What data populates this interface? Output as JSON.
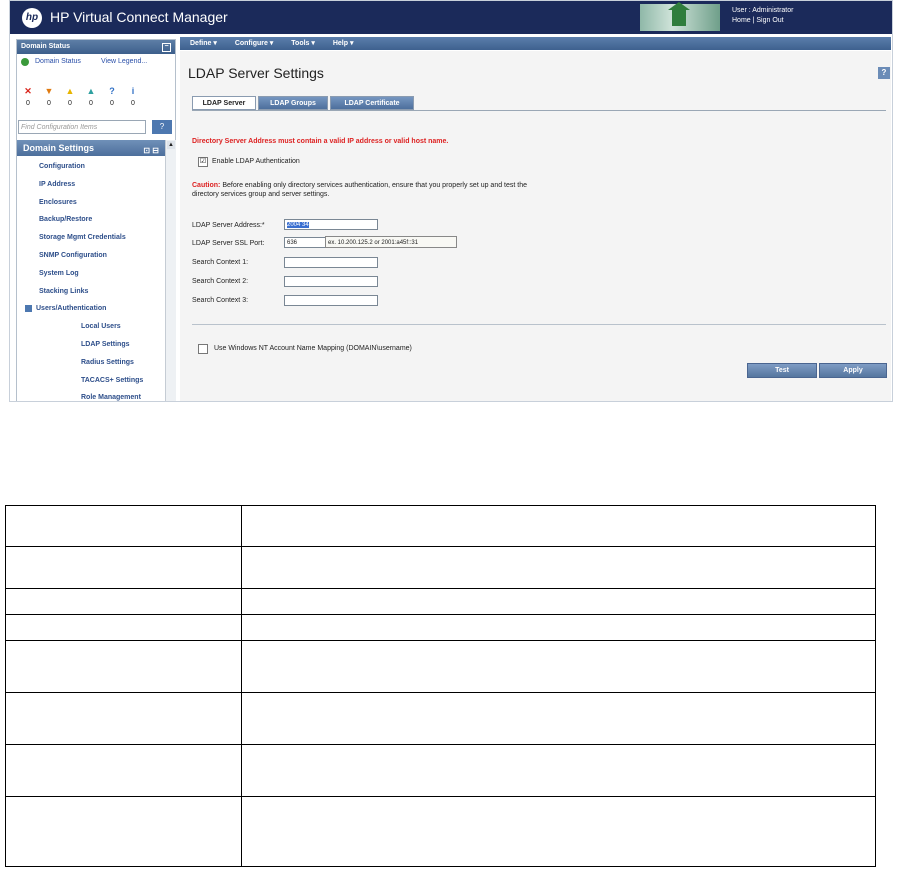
{
  "header": {
    "logo": "hp",
    "title": "HP Virtual Connect Manager",
    "user_line": "User : Administrator",
    "links_line": "Home  |  Sign Out"
  },
  "left_pane": {
    "domain_status_title": "Domain Status",
    "domain_status_link": "Domain Status",
    "view_legend_link": "View Legend...",
    "status_icons": [
      {
        "icon": "critical-icon",
        "symbol": "✕",
        "color": "#d9241b",
        "count": "0"
      },
      {
        "icon": "major-icon",
        "symbol": "▼",
        "color": "#e07a10",
        "count": "0"
      },
      {
        "icon": "minor-icon",
        "symbol": "▲",
        "color": "#e7b500",
        "count": "0"
      },
      {
        "icon": "warning-icon",
        "symbol": "▲",
        "color": "#2ea0a0",
        "count": "0"
      },
      {
        "icon": "unknown-icon",
        "symbol": "?",
        "color": "#2f6fc5",
        "count": "0"
      },
      {
        "icon": "info-icon",
        "symbol": "i",
        "color": "#2f6fc5",
        "count": "0"
      }
    ],
    "find_placeholder": "Find Configuration Items",
    "help_label": "?",
    "domain_settings_title": "Domain Settings",
    "nav_items": [
      {
        "label": "Configuration",
        "level": "l1"
      },
      {
        "label": "IP Address",
        "level": "l1"
      },
      {
        "label": "Enclosures",
        "level": "l1"
      },
      {
        "label": "Backup/Restore",
        "level": "l1"
      },
      {
        "label": "Storage Mgmt Credentials",
        "level": "l1"
      },
      {
        "label": "SNMP Configuration",
        "level": "l1"
      },
      {
        "label": "System Log",
        "level": "l1"
      },
      {
        "label": "Stacking Links",
        "level": "l1"
      },
      {
        "label": "Users/Authentication",
        "level": "grp"
      },
      {
        "label": "Local Users",
        "level": "l2"
      },
      {
        "label": "LDAP Settings",
        "level": "l2"
      },
      {
        "label": "Radius Settings",
        "level": "l2"
      },
      {
        "label": "TACACS+ Settings",
        "level": "l2"
      },
      {
        "label": "Role Management",
        "level": "l2"
      }
    ]
  },
  "menubar": {
    "define": "Define ▾",
    "configure": "Configure ▾",
    "tools": "Tools ▾",
    "help": "Help ▾"
  },
  "page": {
    "title": "LDAP Server Settings",
    "help_icon": "?",
    "tabs": [
      "LDAP Server",
      "LDAP Groups",
      "LDAP Certificate"
    ],
    "error_text": "Directory Server Address must contain a valid IP address or valid host name.",
    "enable_ldap_label": "Enable LDAP Authentication",
    "enable_ldap_checked": "☑",
    "caution_label": "Caution:",
    "caution_text": " Before enabling only directory services authentication, ensure that you properly set up and test the directory services group and server settings.",
    "fields": [
      {
        "label": "LDAP Server Address:*",
        "value": "2004 34"
      },
      {
        "label": "LDAP Server SSL Port:",
        "value": "636"
      },
      {
        "label": "Search Context 1:",
        "value": ""
      },
      {
        "label": "Search Context 2:",
        "value": ""
      },
      {
        "label": "Search Context 3:",
        "value": ""
      }
    ],
    "tooltip": "ex. 10.200.125.2 or 2001:a45f::31",
    "nt_mapping_label": "Use Windows NT Account Name Mapping (DOMAIN\\username)",
    "test_button": "Test",
    "apply_button": "Apply"
  },
  "table": {
    "rows": [
      [
        "",
        ""
      ],
      [
        "",
        ""
      ],
      [
        "",
        ""
      ],
      [
        "",
        ""
      ],
      [
        "",
        ""
      ],
      [
        "",
        ""
      ],
      [
        "",
        ""
      ],
      [
        "",
        ""
      ]
    ]
  }
}
